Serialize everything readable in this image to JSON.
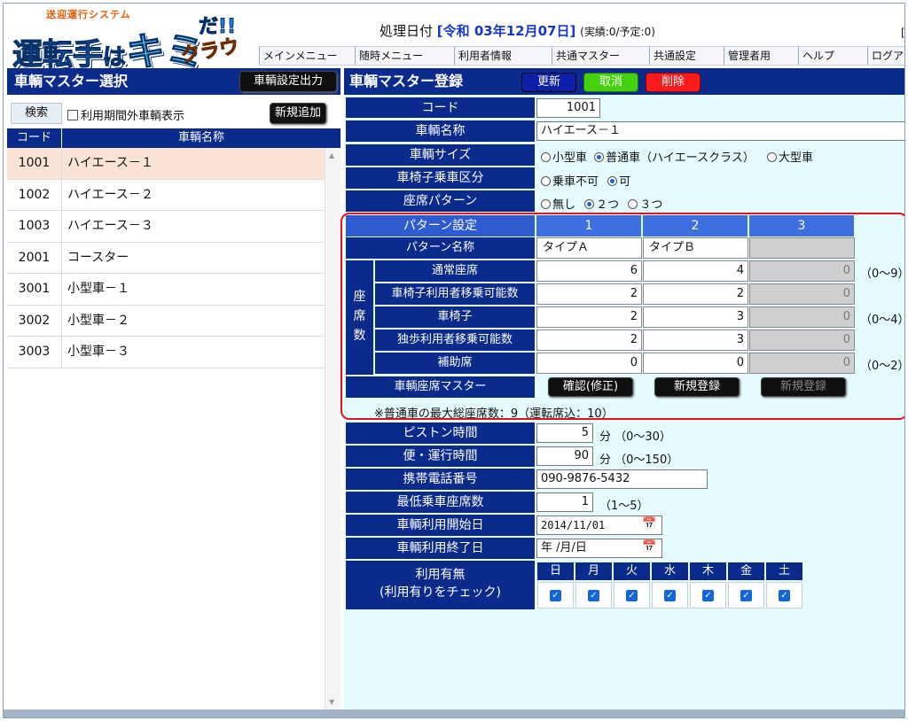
{
  "header": {
    "logo_sub": "送迎運行システム",
    "logo_main_a": "運転手",
    "logo_main_b": "は",
    "logo_main_c": "キミ",
    "logo_da": "だ!!",
    "logo_cloud": "クラウド",
    "proc_date_label": "処理日付",
    "proc_date_value": "[令和 03年12月07日]",
    "proc_counts": "(実績:0/予定:0)",
    "right_bracket": "["
  },
  "menu": [
    "メインメニュー",
    "随時メニュー",
    "利用者情報",
    "共通マスター",
    "共通設定",
    "管理者用",
    "ヘルプ",
    "ログアウ"
  ],
  "left": {
    "title": "車輌マスター選択",
    "export_button": "車輌設定出力",
    "search_label": "検索",
    "search_option": "利用期間外車輌表示",
    "new_button": "新規追加",
    "col_code": "コード",
    "col_name": "車輌名称",
    "rows": [
      {
        "code": "1001",
        "name": "ハイエース－１"
      },
      {
        "code": "1002",
        "name": "ハイエース－２"
      },
      {
        "code": "1003",
        "name": "ハイエース－３"
      },
      {
        "code": "2001",
        "name": "コースター"
      },
      {
        "code": "3001",
        "name": "小型車－１"
      },
      {
        "code": "3002",
        "name": "小型車－２"
      },
      {
        "code": "3003",
        "name": "小型車－３"
      }
    ]
  },
  "right": {
    "title": "車輌マスター登録",
    "update": "更新",
    "cancel": "取消",
    "delete": "削除",
    "code_label": "コード",
    "code_value": "1001",
    "name_label": "車輌名称",
    "name_value": "ハイエース－１",
    "size_label": "車輌サイズ",
    "size_opts": [
      "小型車",
      "普通車（ハイエースクラス）",
      "大型車"
    ],
    "wheel_label": "車椅子乗車区分",
    "wheel_opts": [
      "乗車不可",
      "可"
    ],
    "seat_label": "座席パターン",
    "seat_opts": [
      "無し",
      "２つ",
      "３つ"
    ],
    "pattern": {
      "setting_label": "パターン設定",
      "cols": [
        "1",
        "2",
        "3"
      ],
      "name_label": "パターン名称",
      "names": [
        "タイプＡ",
        "タイプＢ",
        ""
      ],
      "group_label": "座席数",
      "rows": [
        {
          "label": "通常座席",
          "values": [
            "6",
            "4",
            "0"
          ],
          "range": "（0～9）"
        },
        {
          "label": "車椅子利用者移乗可能数",
          "values": [
            "2",
            "2",
            "0"
          ],
          "range": ""
        },
        {
          "label": "車椅子",
          "values": [
            "2",
            "3",
            "0"
          ],
          "range": "（0～4）"
        },
        {
          "label": "独歩利用者移乗可能数",
          "values": [
            "2",
            "3",
            "0"
          ],
          "range": ""
        },
        {
          "label": "補助席",
          "values": [
            "0",
            "0",
            "0"
          ],
          "range": "（0～2）"
        }
      ],
      "seat_master_label": "車輌座席マスター",
      "confirm_button": "確認(修正)",
      "new_button_1": "新規登録",
      "new_button_2": "新規登録",
      "note": "※普通車の最大総座席数：9（運転席込：10）"
    },
    "piston_label": "ピストン時間",
    "piston_value": "5",
    "piston_unit": "分 （0～30）",
    "run_label": "便・運行時間",
    "run_value": "90",
    "run_unit": "分 （0～150）",
    "phone_label": "携帯電話番号",
    "phone_value": "090-9876-5432",
    "min_label": "最低乗車座席数",
    "min_value": "1",
    "min_range": "（1～5）",
    "start_label": "車輌利用開始日",
    "start_value": "2014/11/01",
    "end_label": "車輌利用終了日",
    "end_value": "年 /月/日",
    "use_label_1": "利用有無",
    "use_label_2": "(利用有りをチェック)",
    "days": [
      "日",
      "月",
      "火",
      "水",
      "木",
      "金",
      "土"
    ]
  }
}
